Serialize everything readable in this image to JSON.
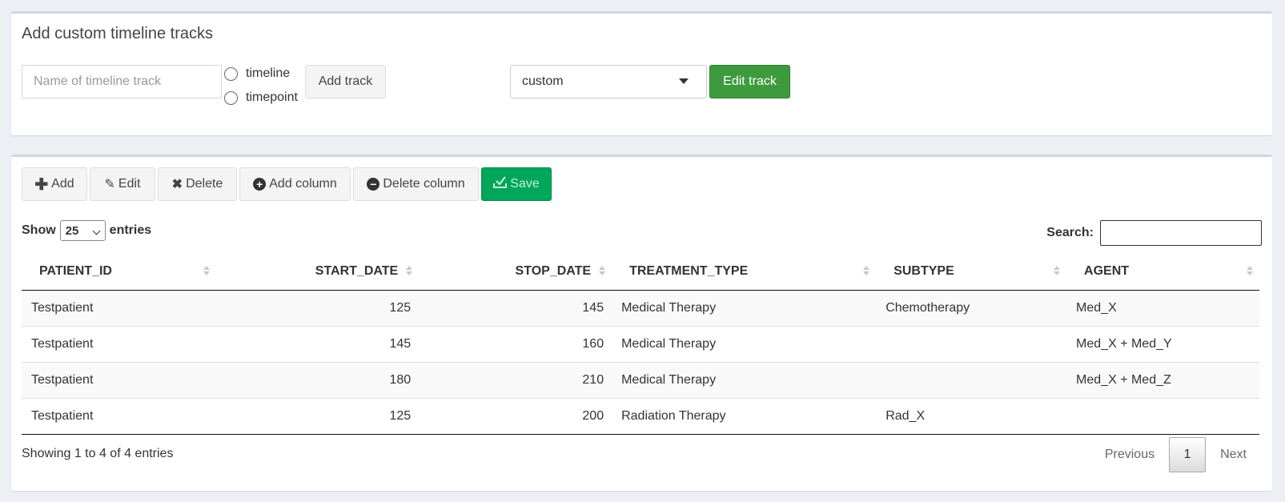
{
  "panel1": {
    "title": "Add custom timeline tracks",
    "track_name_placeholder": "Name of timeline track",
    "radio_options": [
      "timeline",
      "timepoint"
    ],
    "add_track_label": "Add track",
    "track_select_value": "custom",
    "edit_track_label": "Edit track"
  },
  "toolbar": {
    "add": "Add",
    "edit": "Edit",
    "delete": "Delete",
    "add_column": "Add column",
    "delete_column": "Delete column",
    "save": "Save"
  },
  "table_controls": {
    "show_label": "Show",
    "page_length": "25",
    "entries_label": "entries",
    "search_label": "Search:"
  },
  "table": {
    "columns": [
      "PATIENT_ID",
      "START_DATE",
      "STOP_DATE",
      "TREATMENT_TYPE",
      "SUBTYPE",
      "AGENT"
    ],
    "rows": [
      [
        "Testpatient",
        "125",
        "145",
        "Medical Therapy",
        "Chemotherapy",
        "Med_X"
      ],
      [
        "Testpatient",
        "145",
        "160",
        "Medical Therapy",
        "",
        "Med_X + Med_Y"
      ],
      [
        "Testpatient",
        "180",
        "210",
        "Medical Therapy",
        "",
        "Med_X + Med_Z"
      ],
      [
        "Testpatient",
        "125",
        "200",
        "Radiation Therapy",
        "Rad_X",
        ""
      ]
    ]
  },
  "footer": {
    "info": "Showing 1 to 4 of 4 entries",
    "previous": "Previous",
    "current_page": "1",
    "next": "Next"
  },
  "colors": {
    "save_button": "#00a65a",
    "edit_track_button": "#3d9b3d",
    "background": "#ecf0f5"
  }
}
